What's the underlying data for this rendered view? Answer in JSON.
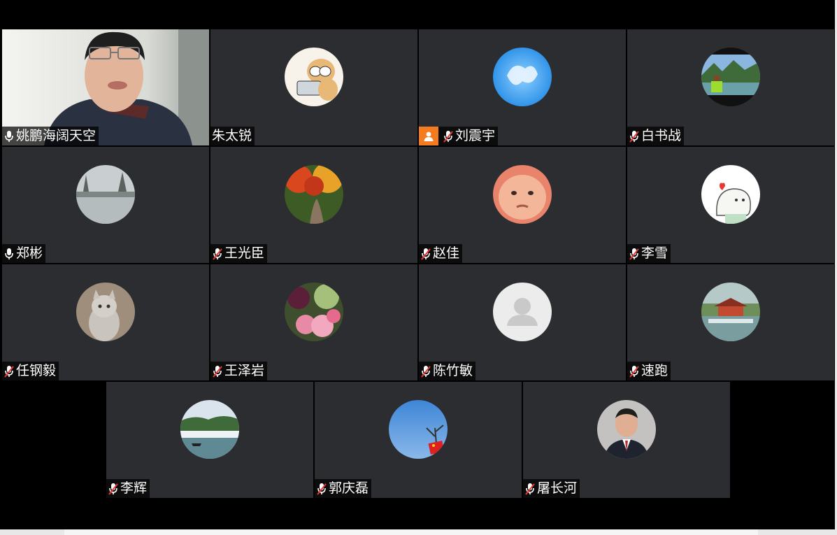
{
  "meeting": {
    "participants": [
      {
        "name": "姚鹏海阔天空",
        "mic": "on",
        "video": true,
        "active": true,
        "avatar": "video-feed"
      },
      {
        "name": "朱太锐",
        "mic": "none",
        "avatar": "cartoon-cat-icon"
      },
      {
        "name": "刘震宇",
        "mic": "muted",
        "host": true,
        "avatar": "cloud-sky-icon"
      },
      {
        "name": "白书战",
        "mic": "muted",
        "avatar": "lake-photo-icon"
      },
      {
        "name": "郑彬",
        "mic": "on",
        "avatar": "misty-lake-icon"
      },
      {
        "name": "王光臣",
        "mic": "muted",
        "avatar": "autumn-path-icon"
      },
      {
        "name": "赵佳",
        "mic": "muted",
        "avatar": "baby-face-icon"
      },
      {
        "name": "李雪",
        "mic": "muted",
        "avatar": "cute-ghost-icon"
      },
      {
        "name": "任钢毅",
        "mic": "muted",
        "avatar": "kitten-icon"
      },
      {
        "name": "王泽岩",
        "mic": "muted",
        "avatar": "flowers-icon"
      },
      {
        "name": "陈竹敏",
        "mic": "muted",
        "avatar": "default-user-icon"
      },
      {
        "name": "速跑",
        "mic": "muted",
        "avatar": "pavilion-icon"
      },
      {
        "name": "李辉",
        "mic": "muted",
        "avatar": "foggy-mountain-icon"
      },
      {
        "name": "郭庆磊",
        "mic": "muted",
        "avatar": "flag-tree-icon"
      },
      {
        "name": "屠长河",
        "mic": "muted",
        "avatar": "man-suit-icon"
      }
    ]
  },
  "colors": {
    "tile_bg": "#2b2d30",
    "active_border": "#2fbf71",
    "host_badge": "#f47b20",
    "muted_slash": "#e53935"
  }
}
